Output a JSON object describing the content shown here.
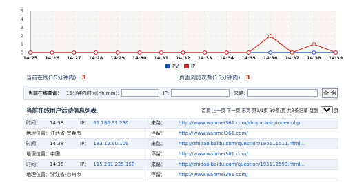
{
  "chart_data": {
    "type": "line",
    "x": [
      "14:25",
      "14:26",
      "14:27",
      "14:28",
      "14:29",
      "14:30",
      "14:31",
      "14:32",
      "14:33",
      "14:34",
      "14:35",
      "14:36",
      "14:37",
      "14:38",
      "14:39"
    ],
    "series": [
      {
        "name": "PV",
        "color": "#1a4ca1",
        "values": [
          0,
          0,
          0,
          0,
          0,
          0,
          0,
          0,
          0,
          0,
          0,
          0,
          0,
          0,
          0
        ]
      },
      {
        "name": "IP",
        "color": "#cf2b22",
        "values": [
          0,
          0,
          0,
          0,
          0,
          0,
          0,
          0,
          0,
          0,
          0,
          2,
          0,
          1,
          0
        ]
      }
    ],
    "y_ticks": [
      "0",
      "1",
      "2",
      "3",
      "4",
      "5"
    ],
    "ylim": [
      0,
      5
    ],
    "grid": true,
    "legend_position": "bottom-center"
  },
  "stats": {
    "online_label": "当前在线(15分钟内)",
    "online_value": "3",
    "pageviews_label": "页面浏览次数(15分钟内)",
    "pageviews_value": "3"
  },
  "query": {
    "label": "当前在线查询：",
    "time_label": "15分钟内时间(hh:mm):",
    "ip_label": "IP:",
    "source_label": "来路:",
    "button_label": "查 询"
  },
  "list": {
    "title": "当前在线用户活动信息列表",
    "pager": {
      "first": "首页",
      "prev": "上一页",
      "next": "下一页",
      "last": "末页",
      "page_info": "第1/1页",
      "per_page": "30条/页",
      "total": "共3条记录",
      "jump": "跳到",
      "page_option": "1",
      "page_suffix": "页"
    },
    "rows": [
      {
        "k1": "时间：",
        "v1": "14:38",
        "k_ip": "IP：",
        "ip": "61.180.31.230",
        "k2": "来路：",
        "v2": "http://www.wanmei361.com/shopadmin/index.php"
      },
      {
        "k1": "地理位置：",
        "v1": "江西省-宜春市",
        "k2": "停留：",
        "v2": "http://www.wanmei361.com/"
      },
      {
        "k1": "时间：",
        "v1": "14:38",
        "k_ip": "IP：",
        "ip": "183.12.90.109",
        "k2": "来路：",
        "v2": "http://zhidao.baidu.com/question/195111511.html..."
      },
      {
        "k1": "地理位置：",
        "v1": "中国",
        "k2": "停留：",
        "v2": "http://www.wanmei361.com/"
      },
      {
        "k1": "时间：",
        "v1": "14:36",
        "k_ip": "IP：",
        "ip": "115.201.225.158",
        "k2": "来路：",
        "v2": "http://zhidao.baidu.com/question/195112593.html..."
      },
      {
        "k1": "地理位置：",
        "v1": "浙江省-台州市",
        "k2": "停留：",
        "v2": "http://www.wanmei361.com/"
      }
    ]
  }
}
